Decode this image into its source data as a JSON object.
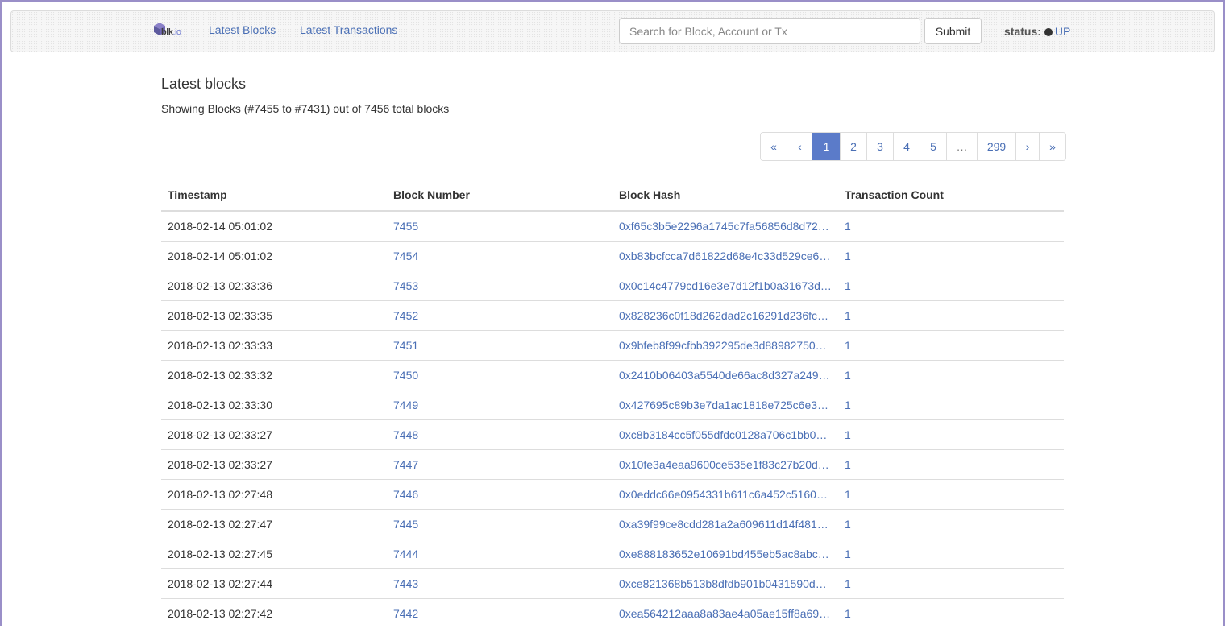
{
  "brand": {
    "name": "blk",
    "tld": ".io",
    "logo_icon": "cube-icon"
  },
  "nav": {
    "latest_blocks": "Latest Blocks",
    "latest_transactions": "Latest Transactions"
  },
  "search": {
    "placeholder": "Search for Block, Account or Tx",
    "value": "",
    "submit_label": "Submit"
  },
  "status": {
    "label": "status:",
    "value": "UP",
    "dot_color": "#333333"
  },
  "page": {
    "title": "Latest blocks",
    "summary": "Showing Blocks (#7455 to #7431) out of 7456 total blocks"
  },
  "pagination": {
    "items": [
      "«",
      "‹",
      "1",
      "2",
      "3",
      "4",
      "5",
      "…",
      "299",
      "›",
      "»"
    ],
    "active": "1"
  },
  "table": {
    "headers": [
      "Timestamp",
      "Block Number",
      "Block Hash",
      "Transaction Count"
    ],
    "rows": [
      {
        "timestamp": "2018-02-14 05:01:02",
        "number": "7455",
        "hash": "0xf65c3b5e2296a1745c7fa56856d8d72…",
        "tx_count": "1"
      },
      {
        "timestamp": "2018-02-14 05:01:02",
        "number": "7454",
        "hash": "0xb83bcfcca7d61822d68e4c33d529ce6…",
        "tx_count": "1"
      },
      {
        "timestamp": "2018-02-13 02:33:36",
        "number": "7453",
        "hash": "0x0c14c4779cd16e3e7d12f1b0a31673d…",
        "tx_count": "1"
      },
      {
        "timestamp": "2018-02-13 02:33:35",
        "number": "7452",
        "hash": "0x828236c0f18d262dad2c16291d236fc…",
        "tx_count": "1"
      },
      {
        "timestamp": "2018-02-13 02:33:33",
        "number": "7451",
        "hash": "0x9bfeb8f99cfbb392295de3d88982750…",
        "tx_count": "1"
      },
      {
        "timestamp": "2018-02-13 02:33:32",
        "number": "7450",
        "hash": "0x2410b06403a5540de66ac8d327a249…",
        "tx_count": "1"
      },
      {
        "timestamp": "2018-02-13 02:33:30",
        "number": "7449",
        "hash": "0x427695c89b3e7da1ac1818e725c6e3…",
        "tx_count": "1"
      },
      {
        "timestamp": "2018-02-13 02:33:27",
        "number": "7448",
        "hash": "0xc8b3184cc5f055dfdc0128a706c1bb0…",
        "tx_count": "1"
      },
      {
        "timestamp": "2018-02-13 02:33:27",
        "number": "7447",
        "hash": "0x10fe3a4eaa9600ce535e1f83c27b20d…",
        "tx_count": "1"
      },
      {
        "timestamp": "2018-02-13 02:27:48",
        "number": "7446",
        "hash": "0x0eddc66e0954331b611c6a452c5160…",
        "tx_count": "1"
      },
      {
        "timestamp": "2018-02-13 02:27:47",
        "number": "7445",
        "hash": "0xa39f99ce8cdd281a2a609611d14f481…",
        "tx_count": "1"
      },
      {
        "timestamp": "2018-02-13 02:27:45",
        "number": "7444",
        "hash": "0xe888183652e10691bd455eb5ac8abc…",
        "tx_count": "1"
      },
      {
        "timestamp": "2018-02-13 02:27:44",
        "number": "7443",
        "hash": "0xce821368b513b8dfdb901b0431590d…",
        "tx_count": "1"
      },
      {
        "timestamp": "2018-02-13 02:27:42",
        "number": "7442",
        "hash": "0xea564212aaa8a83ae4a05ae15ff8a69…",
        "tx_count": "1"
      }
    ]
  },
  "colors": {
    "link": "#4a6fb5",
    "active_page": "#5b7bc9",
    "frame": "#9a8fc8"
  }
}
